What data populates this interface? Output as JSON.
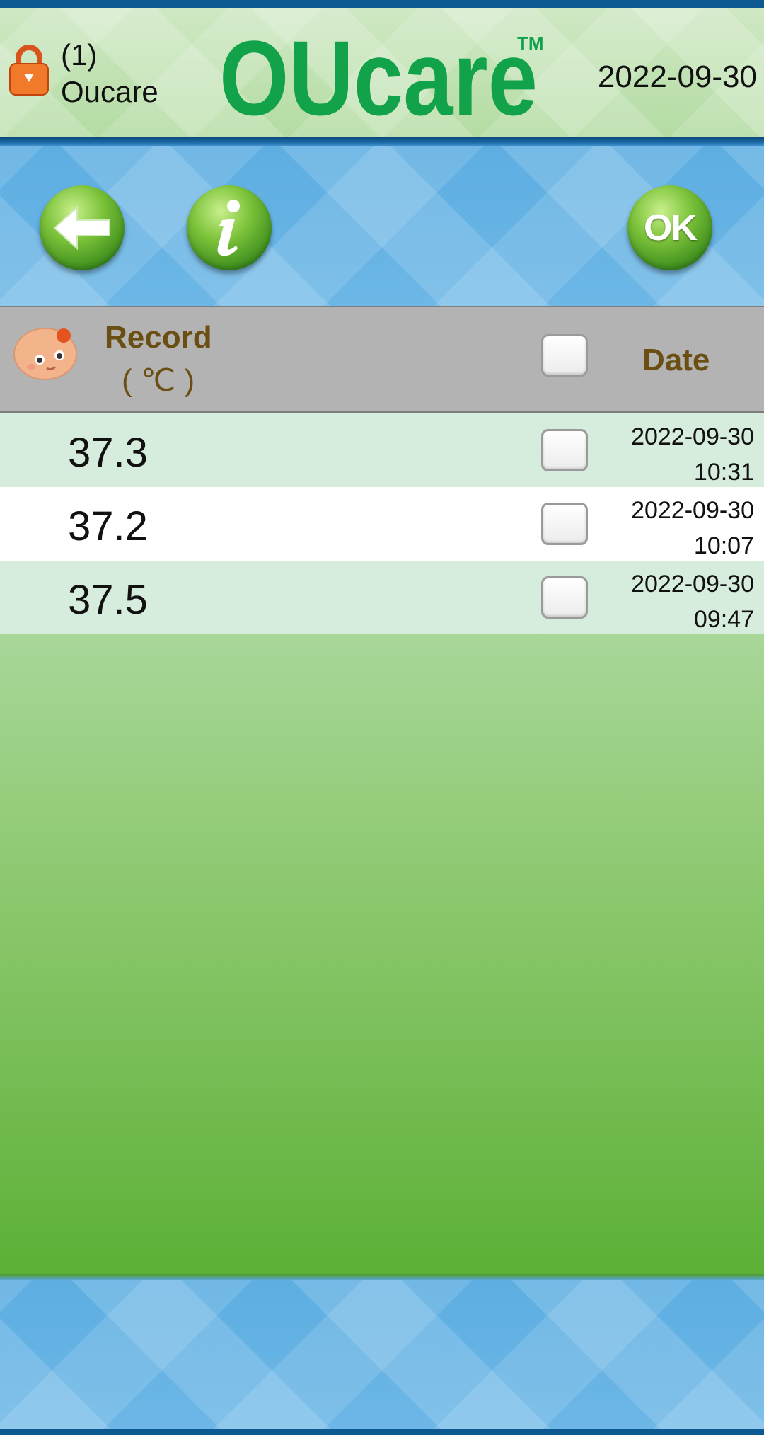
{
  "header": {
    "user_number": "(1)",
    "user_name": "Oucare",
    "brand": "OUcare",
    "trademark": "TM",
    "date": "2022-09-30"
  },
  "toolbar": {
    "back_icon": "arrow-left-icon",
    "info_icon": "info-icon",
    "ok_label": "OK"
  },
  "table": {
    "record_label": "Record",
    "unit_label": "( ℃ )",
    "date_label": "Date",
    "rows": [
      {
        "value": "37.3",
        "date": "2022-09-30",
        "time": "10:31",
        "checked": false
      },
      {
        "value": "37.2",
        "date": "2022-09-30",
        "time": "10:07",
        "checked": false
      },
      {
        "value": "37.5",
        "date": "2022-09-30",
        "time": "09:47",
        "checked": false
      }
    ]
  },
  "colors": {
    "brand_green": "#12a24a",
    "header_text_brown": "#6b4e12",
    "row_alt": "#d6ecdc",
    "row_plain": "#ffffff"
  }
}
